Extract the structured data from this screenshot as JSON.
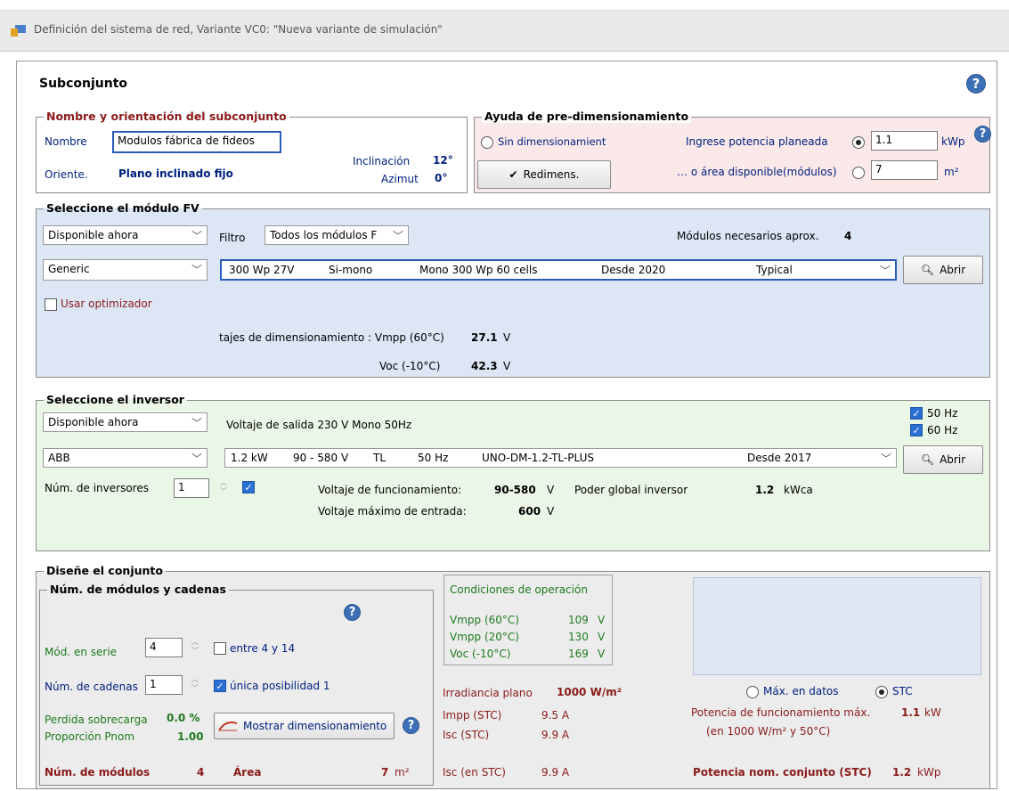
{
  "window": {
    "title": "Definición del sistema de red, Variante VC0:  \"Nueva variante de simulación\""
  },
  "header": {
    "title": "Subconjunto"
  },
  "name_group": {
    "legend": "Nombre y orientación del subconjunto",
    "name_label": "Nombre",
    "name_value": "Modulos fábrica de fideos",
    "orient_label": "Oriente.",
    "orient_value": "Plano inclinado fijo",
    "tilt_label": "Inclinación",
    "tilt_value": "12°",
    "azimuth_label": "Azimut",
    "azimuth_value": "0°"
  },
  "presizing": {
    "legend": "Ayuda de pre-dimensionamiento",
    "no_sizing": "Sin dimensionamient",
    "power_label": "Ingrese potencia planeada",
    "power_value": "1.1",
    "power_unit": "kWp",
    "area_label": "… o área disponible(módulos)",
    "area_value": "7",
    "area_unit": "m²",
    "resize_button": "Redimens."
  },
  "module": {
    "legend": "Seleccione el módulo FV",
    "availability": "Disponible ahora",
    "filter_label": "Filtro",
    "filter_value": "Todos los módulos F",
    "needed_label": "Módulos necesarios aprox.",
    "needed_value": "4",
    "manufacturer": "Generic",
    "model": {
      "power": "300 Wp 27V",
      "tech": "Si-mono",
      "name": "Mono 300 Wp 60 cells",
      "since": "Desde 2020",
      "type": "Typical"
    },
    "open_button": "Abrir",
    "optimizer_label": "Usar optimizador",
    "sizing_label": "tajes de dimensionamiento : Vmpp (60°C)",
    "vmpp_value": "27.1",
    "vmpp_unit": "V",
    "voc_label": "Voc (-10°C)",
    "voc_value": "42.3",
    "voc_unit": "V"
  },
  "inverter": {
    "legend": "Seleccione el inversor",
    "availability": "Disponible ahora",
    "output_voltage": "Voltaje de salida 230 V Mono 50Hz",
    "hz50": "50 Hz",
    "hz60": "60 Hz",
    "manufacturer": "ABB",
    "model": {
      "power": "1.2 kW",
      "range": "90 - 580 V",
      "tl": "TL",
      "freq": "50 Hz",
      "name": "UNO-DM-1.2-TL-PLUS",
      "since": "Desde 2017"
    },
    "open_button": "Abrir",
    "count_label": "Núm. de inversores",
    "count_value": "1",
    "op_voltage_label": "Voltaje de funcionamiento:",
    "op_voltage_value": "90-580",
    "op_voltage_unit": "V",
    "global_power_label": "Poder global inversor",
    "global_power_value": "1.2",
    "global_power_unit": "kWca",
    "max_voltage_label": "Voltaje máximo de entrada:",
    "max_voltage_value": "600",
    "max_voltage_unit": "V"
  },
  "design": {
    "legend": "Diseñe el conjunto",
    "strings_legend": "Núm. de módulos y cadenas",
    "series_label": "Mód. en serie",
    "series_value": "4",
    "series_range": "entre 4 y 14",
    "strings_label": "Núm. de cadenas",
    "strings_value": "1",
    "strings_note": "única posibilidad 1",
    "overload_label": "Perdida sobrecarga",
    "overload_value": "0.0 %",
    "ratio_label": "Proporción Pnom",
    "ratio_value": "1.00",
    "show_sizing_button": "Mostrar dimensionamiento",
    "modules_label": "Núm. de módulos",
    "modules_value": "4",
    "area_label": "Área",
    "area_value": "7",
    "area_unit": "m²",
    "op_conditions": {
      "title": "Condiciones de operación",
      "rows": [
        {
          "label": "Vmpp (60°C)",
          "value": "109",
          "unit": "V"
        },
        {
          "label": "Vmpp (20°C)",
          "value": "130",
          "unit": "V"
        },
        {
          "label": "Voc (-10°C)",
          "value": "169",
          "unit": "V"
        }
      ]
    },
    "irradiance_label": "Irradiancia plano",
    "irradiance_value": "1000 W/m²",
    "impp_label": "Impp (STC)",
    "impp_value": "9.5 A",
    "isc_label": "Isc (STC)",
    "isc_value": "9.9 A",
    "isc_stc_label": "Isc (en STC)",
    "isc_stc_value": "9.9 A",
    "radio_max": "Máx. en datos",
    "radio_stc": "STC",
    "max_power_label": "Potencia de funcionamiento máx.",
    "max_power_value": "1.1",
    "max_power_unit": "kW",
    "max_power_cond": "(en 1000 W/m²  y 50°C)",
    "nominal_label": "Potencia nom. conjunto (STC)",
    "nominal_value": "1.2",
    "nominal_unit": "kWp"
  },
  "colors": {
    "accent": "#2a5bb8",
    "module_bg": "#dde6f5",
    "inverter_bg": "#eaf6e6",
    "presizing_bg": "#fbe9e9",
    "design_bg": "#ececec"
  }
}
